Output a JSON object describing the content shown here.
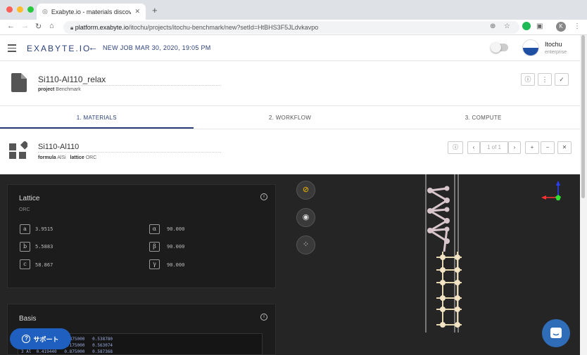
{
  "browser": {
    "tab_title": "Exabyte.io - materials discover",
    "url_host": "platform.exabyte.io",
    "url_path": "/itochu/projects/itochu-benchmark/new?setId=HtBHS3F5JLdvkavpo",
    "profile_initial": "K"
  },
  "header": {
    "logo": "EXABYTE.IO",
    "job_title": "NEW JOB MAR 30, 2020, 19:05 PM",
    "user_name": "Itochu",
    "user_role": "enterprise"
  },
  "job": {
    "name": "Si110-Al110_relax",
    "project_label": "project",
    "project_value": "Benchmark"
  },
  "tabs": [
    "1. MATERIALS",
    "2. WORKFLOW",
    "3. COMPUTE"
  ],
  "material": {
    "name": "Si110-Al110",
    "formula_label": "formula",
    "formula_value": "AlSi",
    "lattice_label": "lattice",
    "lattice_value": "ORC",
    "pager": "1 of 1"
  },
  "lattice": {
    "title": "Lattice",
    "type": "ORC",
    "params": [
      {
        "label": "a",
        "value": "3.9515"
      },
      {
        "label": "b",
        "value": "5.5883"
      },
      {
        "label": "c",
        "value": "58.867"
      },
      {
        "label": "α",
        "value": "90.000"
      },
      {
        "label": "β",
        "value": "90.000"
      },
      {
        "label": "γ",
        "value": "90.000"
      }
    ]
  },
  "basis": {
    "title": "Basis",
    "rows": [
      "1 Al  0.419440   0.875000   0.538780",
      "2 Al  0.419440   0.175000   0.563074",
      "3 Al  0.419440   0.875000   0.587368"
    ]
  },
  "support_label": "サポート",
  "colors": {
    "brand": "#2a3f7a",
    "viewer_bg": "#252525",
    "support_bg": "#1e5fbf"
  }
}
